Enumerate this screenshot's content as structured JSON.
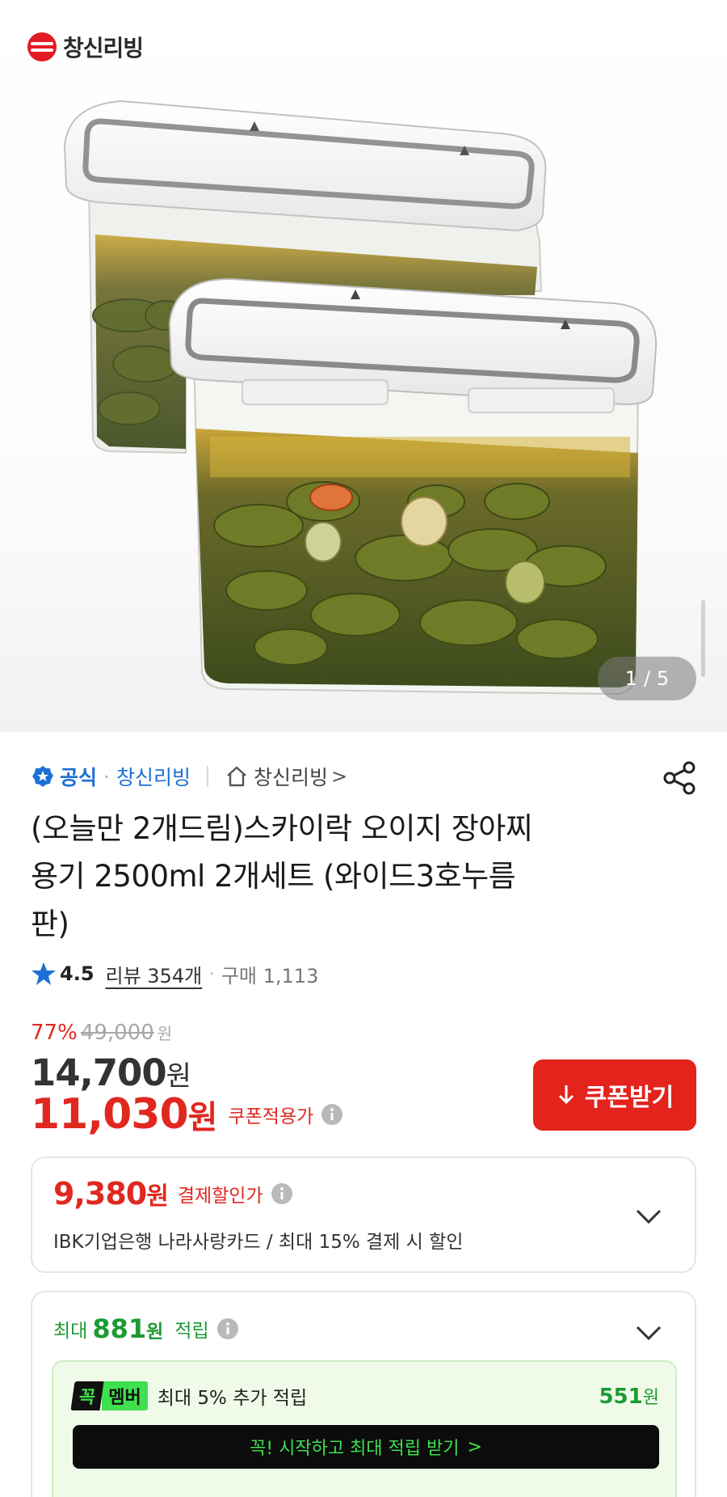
{
  "brand": {
    "logo_text": "창신리빙",
    "brand_color": "#e31b23"
  },
  "gallery": {
    "current": "1",
    "separator": "/",
    "total": "5"
  },
  "seller": {
    "official_label": "공식",
    "separator": "·",
    "name": "창신리빙",
    "store_link": "창신리빙",
    "store_arrow": ">",
    "icons": [
      "official-badge-icon",
      "home-icon",
      "share-icon"
    ]
  },
  "product": {
    "title_lines": [
      "(오늘만 2개드림)스카이락 오이지 장아찌",
      "용기 2500ml 2개세트 (와이드3호누름",
      "판)"
    ]
  },
  "rating": {
    "score": "4.5",
    "reviews": "리뷰 354개",
    "separator": "·",
    "purchases": "구매 1,113"
  },
  "pricing": {
    "discount_pct": "77%",
    "original_price": "49,000",
    "original_unit": "원",
    "price": "14,700",
    "price_unit": "원",
    "coupon_price": "11,030",
    "coupon_unit": "원",
    "coupon_label": "쿠폰적용가",
    "coupon_button": "쿠폰받기"
  },
  "payment_discount": {
    "price": "9,380",
    "unit": "원",
    "label": "결제할인가",
    "detail": "IBK기업은행 나라사랑카드 / 최대 15% 결제 시 할인"
  },
  "reward": {
    "prefix": "최대",
    "amount": "881",
    "unit": "원",
    "label": "적립",
    "member": {
      "badge_left": "꼭",
      "badge_right": "멤버",
      "text": "최대 5% 추가 적립",
      "amount": "551",
      "unit": "원",
      "button": "꼭! 시작하고 최대 적립 받기",
      "button_arrow": ">"
    }
  },
  "colors": {
    "accent_red": "#e0281f",
    "coupon_button": "#e3231c",
    "official_blue": "#1c6fd6",
    "reward_green": "#1d9b33",
    "member_green": "#3ee04d"
  }
}
